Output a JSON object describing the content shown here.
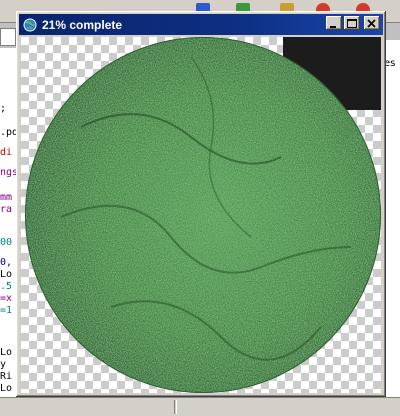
{
  "window": {
    "title": "21% complete",
    "progress_percent": 21
  },
  "title_buttons": {
    "minimize": "minimize-icon",
    "maximize": "maximize-icon",
    "close": "close-icon"
  },
  "background_app": {
    "code_fragments": [
      ";",
      "",
      ".pd",
      "di",
      "ngs",
      "mm",
      "ra",
      "",
      "00",
      "0,",
      "Lo",
      ".5",
      "=x",
      "=1",
      "",
      "",
      "Lo",
      "y",
      "Ri",
      "Lo"
    ],
    "right_pane_text": "es"
  },
  "colors": {
    "titlebar": "#0a246a",
    "globe_base": "#3a7a3a",
    "globe_highlight": "#6fb36a"
  }
}
